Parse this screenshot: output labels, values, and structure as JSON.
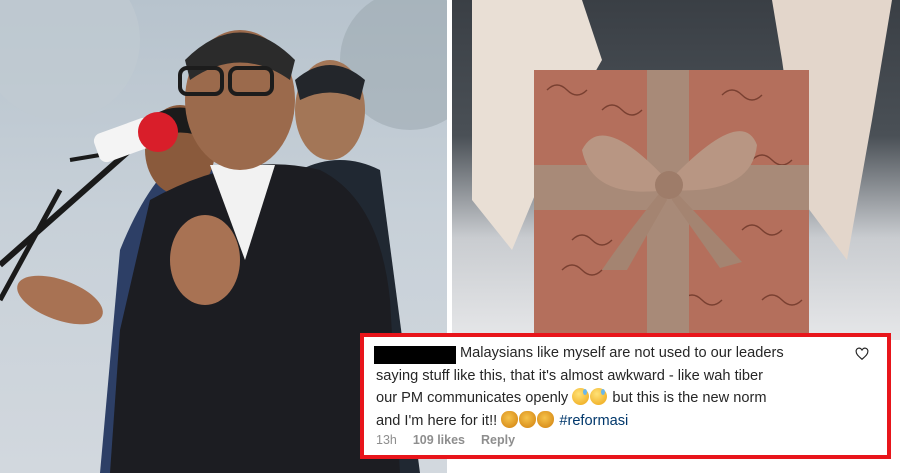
{
  "comment": {
    "text_line_1": "Malaysians like myself are not used to our leaders",
    "text_line_2": "saying stuff like this, that it's almost awkward - like wah tiber",
    "text_line_3": "our PM communicates openly",
    "text_line_3b": "but this is the new norm",
    "text_line_4": "and I'm here for it!!",
    "hashtag": "#reformasi",
    "time": "13h",
    "likes": "109 likes",
    "reply_label": "Reply",
    "icons": [
      "heart-icon",
      "sweat-smile-emoji",
      "clapping-hands-emoji"
    ],
    "highlight_color": "#e8151b"
  }
}
